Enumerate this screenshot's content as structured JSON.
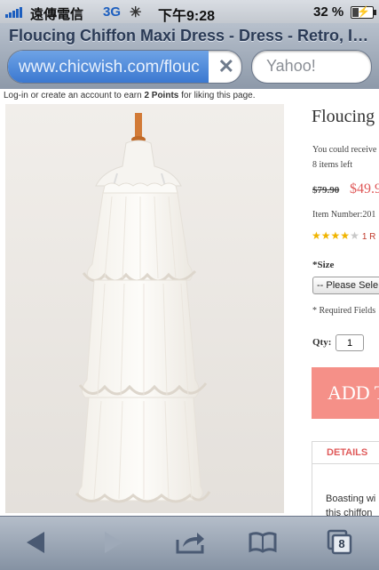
{
  "status_bar": {
    "carrier": "遠傳電信",
    "network": "3G",
    "time": "下午9:28",
    "battery": "32 %",
    "battery_level": 0.32
  },
  "browser": {
    "page_title": "Floucing Chiffon Maxi Dress - Dress - Retro, In...",
    "url": "www.chicwish.com/flouc",
    "load_progress": 0.86,
    "search_placeholder": "Yahoo!",
    "open_tabs": "8"
  },
  "page": {
    "login_note_pre": "Log-in or create an account to earn",
    "login_note_points": "2 Points",
    "login_note_post": "for liking this page.",
    "product": {
      "name": "Floucing",
      "points_note": "You could receive",
      "stock": "8 items left",
      "old_price": "$79.90",
      "new_price": "$49.9",
      "item_number": "Item Number:201",
      "rating": 4,
      "rating_max": 5,
      "review_count": "1 R",
      "size_label": "*Size",
      "size_select": "-- Please Sele",
      "required_note": "* Required Fields",
      "qty_label": "Qty:",
      "qty_value": "1",
      "add_button": "ADD T",
      "details_tab": "DETAILS",
      "details_line1": "Boasting wi",
      "details_line2": "this chiffon"
    }
  },
  "colors": {
    "accent_blue": "#3b78d0",
    "price_red": "#e05a5a",
    "add_button": "#f59088",
    "star": "#f0b400"
  },
  "icons": {
    "back": "back-arrow-icon",
    "forward": "forward-arrow-icon",
    "share": "share-icon",
    "bookmarks": "bookmarks-book-icon",
    "tabs": "tabs-icon"
  }
}
